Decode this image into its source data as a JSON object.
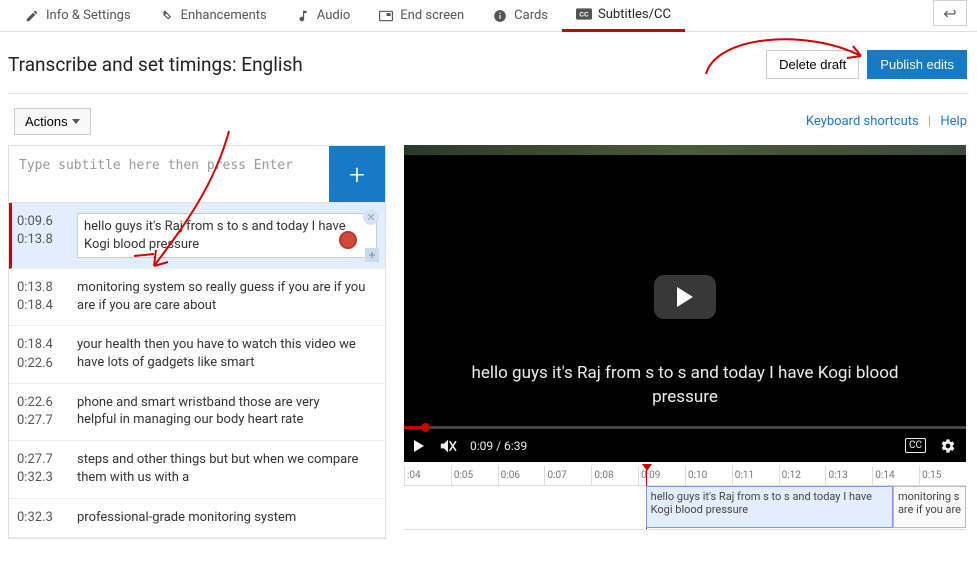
{
  "tabs": {
    "info": "Info & Settings",
    "enhance": "Enhancements",
    "audio": "Audio",
    "endscreen": "End screen",
    "cards": "Cards",
    "cc": "Subtitles/CC"
  },
  "header": {
    "title": "Transcribe and set timings: English",
    "delete": "Delete draft",
    "publish": "Publish edits"
  },
  "actions_label": "Actions",
  "help": {
    "shortcuts": "Keyboard shortcuts",
    "help": "Help"
  },
  "input_placeholder": "Type subtitle here then press Enter",
  "plus": "+",
  "rows": [
    {
      "start": "0:09.6",
      "end": "0:13.8",
      "text": "hello guys it's Raj from s to s and today I have Kogi blood pressure",
      "active": true
    },
    {
      "start": "0:13.8",
      "end": "0:18.4",
      "text": "monitoring system so really guess if you are if you are if you are care about"
    },
    {
      "start": "0:18.4",
      "end": "0:22.6",
      "text": "your health then you have to watch this video we have lots of gadgets like smart"
    },
    {
      "start": "0:22.6",
      "end": "0:27.7",
      "text": "phone and smart wristband those are very\nhelpful in managing our body heart rate"
    },
    {
      "start": "0:27.7",
      "end": "0:32.3",
      "text": "steps and other things but but when we compare them with us with a"
    },
    {
      "start": "0:32.3",
      "end": "",
      "text": "professional-grade monitoring system"
    }
  ],
  "player": {
    "caption": "hello guys it's Raj from s to s and today I have Kogi blood pressure",
    "time": "0:09 / 6:39"
  },
  "timeline": {
    "ticks": [
      ":04",
      "0:05",
      "0:06",
      "0:07",
      "0:08",
      "0:09",
      "0:10",
      "0:11",
      "0:12",
      "0:13",
      "0:14",
      "0:15"
    ],
    "playhead_percent": 43,
    "seg1": {
      "text": "hello guys it's Raj from s to s and today I have Kogi blood pressure",
      "left_pct": 43,
      "width_pct": 44
    },
    "seg2": {
      "text": "monitoring s\nare if you are",
      "left_pct": 87,
      "width_pct": 13
    }
  }
}
